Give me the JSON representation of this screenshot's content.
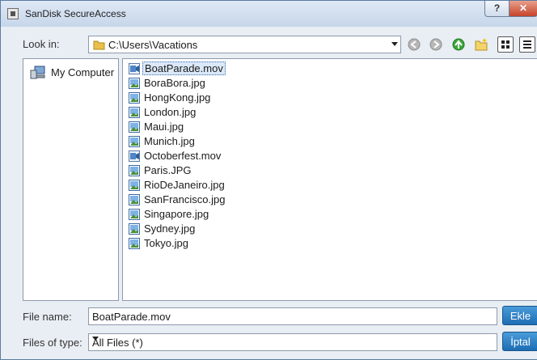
{
  "window": {
    "title": "SanDisk SecureAccess",
    "help": "?",
    "close": "✕"
  },
  "lookin": {
    "label": "Look in:",
    "path": "C:\\Users\\Vacations"
  },
  "sidebar": {
    "items": [
      {
        "label": "My Computer",
        "icon": "computer-icon"
      }
    ]
  },
  "files": [
    {
      "name": "BoatParade.mov",
      "type": "video",
      "selected": true
    },
    {
      "name": "BoraBora.jpg",
      "type": "image"
    },
    {
      "name": "HongKong.jpg",
      "type": "image"
    },
    {
      "name": "London.jpg",
      "type": "image"
    },
    {
      "name": "Maui.jpg",
      "type": "image"
    },
    {
      "name": "Munich.jpg",
      "type": "image"
    },
    {
      "name": "Octoberfest.mov",
      "type": "video"
    },
    {
      "name": "Paris.JPG",
      "type": "image"
    },
    {
      "name": "RioDeJaneiro.jpg",
      "type": "image"
    },
    {
      "name": "SanFrancisco.jpg",
      "type": "image"
    },
    {
      "name": "Singapore.jpg",
      "type": "image"
    },
    {
      "name": "Sydney.jpg",
      "type": "image"
    },
    {
      "name": "Tokyo.jpg",
      "type": "image"
    }
  ],
  "filename": {
    "label": "File name:",
    "value": "BoatParade.mov"
  },
  "filetype": {
    "label": "Files of type:",
    "value": "All Files (*)"
  },
  "buttons": {
    "add": "Ekle",
    "cancel": "İptal"
  },
  "colors": {
    "accent": "#1d6db4",
    "selection": "#dbe8f8"
  }
}
